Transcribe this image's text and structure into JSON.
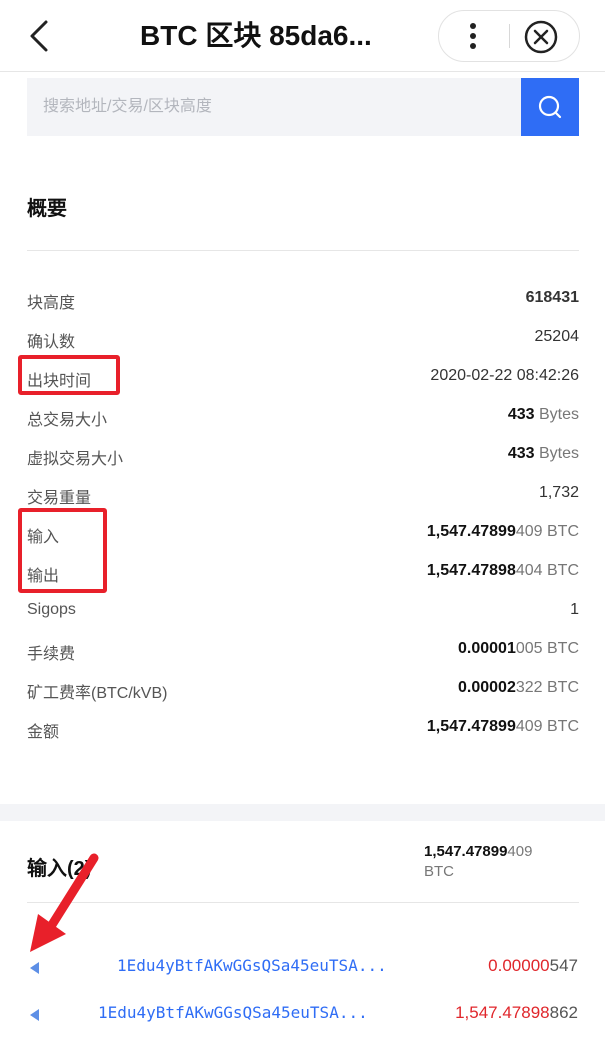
{
  "header": {
    "title": "BTC 区块 85da6...",
    "back_icon": "chevron-left-icon",
    "more_icon": "more-vertical-icon",
    "close_icon": "close-circle-icon"
  },
  "search": {
    "placeholder": "搜索地址/交易/区块高度",
    "value": "",
    "button_icon": "search-icon"
  },
  "overview": {
    "title": "概要",
    "rows": [
      {
        "label": "块高度",
        "value": "618431"
      },
      {
        "label": "确认数",
        "value": "25204"
      },
      {
        "label": "出块时间",
        "value": "2020-02-22 08:42:26"
      },
      {
        "label": "总交易大小",
        "value_main": "433",
        "value_unit": "Bytes"
      },
      {
        "label": "虚拟交易大小",
        "value_main": "433",
        "value_unit": "Bytes"
      },
      {
        "label": "交易重量",
        "value": "1,732"
      },
      {
        "label": "输入",
        "value_main": "1,547.47899",
        "value_tail": "409 BTC"
      },
      {
        "label": "输出",
        "value_main": "1,547.47898",
        "value_tail": "404 BTC"
      },
      {
        "label": "Sigops",
        "value": "1"
      },
      {
        "label": "手续费",
        "value_main": "0.00001",
        "value_tail": "005 BTC"
      },
      {
        "label": "矿工费率(BTC/kVB)",
        "value_main": "0.00002",
        "value_tail": "322 BTC"
      },
      {
        "label": "金额",
        "value_main": "1,547.47899",
        "value_tail": "409 BTC"
      }
    ]
  },
  "inputs": {
    "title": "输入(2)",
    "total_main": "1,547.47899",
    "total_tail": "409",
    "total_unit": "BTC",
    "items": [
      {
        "address": "1Edu4yBtfAKwGGsQSa45euTSA...",
        "amount_main": "0.00000",
        "amount_tail": "547"
      },
      {
        "address": "1Edu4yBtfAKwGGsQSa45euTSA...",
        "amount_main": "1,547.47898",
        "amount_tail": "862"
      }
    ]
  },
  "colors": {
    "accent": "#2f6df5",
    "annotation_red": "#e8202a",
    "amount_red": "#e0262b"
  }
}
